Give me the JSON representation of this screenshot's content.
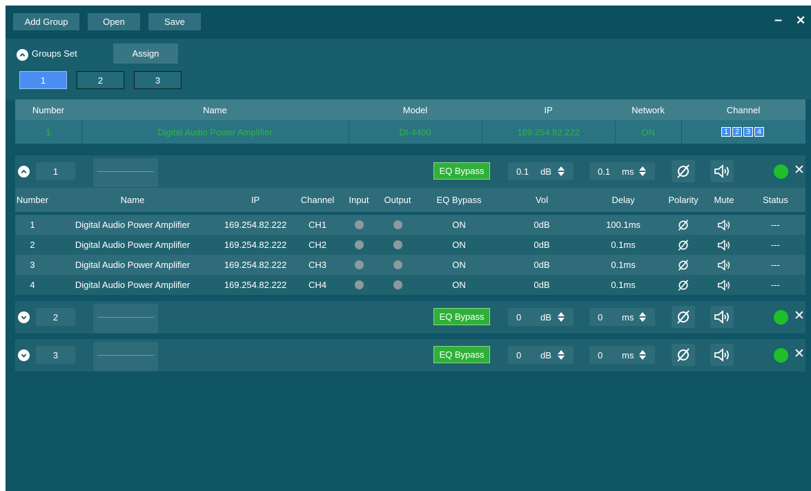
{
  "toolbar": {
    "add_group": "Add Group",
    "open": "Open",
    "save": "Save",
    "minimize": "–",
    "close": "✕"
  },
  "groups_set": {
    "label": "Groups Set",
    "assign": "Assign",
    "boxes": [
      {
        "label": "1",
        "active": true
      },
      {
        "label": "2",
        "active": false
      },
      {
        "label": "3",
        "active": false
      }
    ]
  },
  "device_table": {
    "headers": [
      "Number",
      "Name",
      "Model",
      "IP",
      "Network",
      "Channel"
    ],
    "row": {
      "number": "1",
      "name": "Digital Audio Power Amplifier",
      "model": "DI-4400",
      "ip": "169.254.82.222",
      "network": "ON",
      "channels": [
        "1",
        "2",
        "3",
        "4"
      ]
    }
  },
  "groups": [
    {
      "number": "1",
      "eq_bypass": "EQ Bypass",
      "vol": "0.1",
      "vol_unit": "dB",
      "delay": "0.1",
      "delay_unit": "ms",
      "expanded": true
    },
    {
      "number": "2",
      "eq_bypass": "EQ Bypass",
      "vol": "0",
      "vol_unit": "dB",
      "delay": "0",
      "delay_unit": "ms",
      "expanded": false
    },
    {
      "number": "3",
      "eq_bypass": "EQ Bypass",
      "vol": "0",
      "vol_unit": "dB",
      "delay": "0",
      "delay_unit": "ms",
      "expanded": false
    }
  ],
  "channel_table": {
    "headers": [
      "Number",
      "Name",
      "IP",
      "Channel",
      "Input",
      "Output",
      "EQ Bypass",
      "Vol",
      "Delay",
      "Polarity",
      "Mute",
      "Status"
    ],
    "rows": [
      {
        "number": "1",
        "name": "Digital Audio Power Amplifier",
        "ip": "169.254.82.222",
        "channel": "CH1",
        "eq": "ON",
        "vol": "0dB",
        "delay": "100.1ms",
        "status": "---"
      },
      {
        "number": "2",
        "name": "Digital Audio Power Amplifier",
        "ip": "169.254.82.222",
        "channel": "CH2",
        "eq": "ON",
        "vol": "0dB",
        "delay": "0.1ms",
        "status": "---"
      },
      {
        "number": "3",
        "name": "Digital Audio Power Amplifier",
        "ip": "169.254.82.222",
        "channel": "CH3",
        "eq": "ON",
        "vol": "0dB",
        "delay": "0.1ms",
        "status": "---"
      },
      {
        "number": "4",
        "name": "Digital Audio Power Amplifier",
        "ip": "169.254.82.222",
        "channel": "CH4",
        "eq": "ON",
        "vol": "0dB",
        "delay": "0.1ms",
        "status": "---"
      }
    ]
  },
  "colors": {
    "background": "#0f5566",
    "accent_green": "#2fb03a",
    "status_green": "#1fbf2b",
    "active_blue": "#4a8ef2",
    "text_green": "#2ab93a"
  },
  "icons": {
    "collapse": "chevron-up-icon",
    "expand": "chevron-down-icon",
    "polarity": "polarity-icon",
    "mute": "speaker-icon",
    "status": "status-dot",
    "remove": "close-icon"
  }
}
